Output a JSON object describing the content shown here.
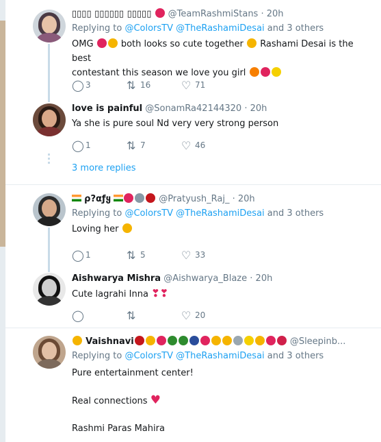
{
  "tweets": [
    {
      "name": "▯▯▯▯ ▯▯▯▯▯▯ ▯▯▯▯▯",
      "handle": "@TeamRashmiStans",
      "time": "· 20h",
      "replying_prefix": "Replying to",
      "mention1": "@ColorsTV",
      "mention2": "@TheRashamiDesai",
      "replying_suffix": "and 3 others",
      "text1": "OMG",
      "text2": "both looks so cute together",
      "text3": "Rashami Desai is the best",
      "text4": "contestant this season we love you girl",
      "replies": "3",
      "retweets": "16",
      "likes": "71"
    },
    {
      "name": "love is painful",
      "handle": "@SonamRa42144320",
      "time": "· 20h",
      "text1": "Ya she is pure soul Nd very very strong person",
      "replies": "1",
      "retweets": "7",
      "likes": "46"
    },
    {
      "more_replies": "3 more replies"
    },
    {
      "name": "ρ?αƒყ",
      "handle": "@Pratyush_Raj_",
      "time": "· 20h",
      "replying_prefix": "Replying to",
      "mention1": "@ColorsTV",
      "mention2": "@TheRashamiDesai",
      "replying_suffix": "and 3 others",
      "text1": "Loving her",
      "replies": "1",
      "retweets": "5",
      "likes": "33"
    },
    {
      "name": "Aishwarya Mishra",
      "handle": "@Aishwarya_Blaze",
      "time": "· 20h",
      "text1": "Cute lagrahi Inna",
      "likes": "20"
    },
    {
      "name": "Vaishnavi",
      "handle": "@Sleepinb...",
      "replying_prefix": "Replying to",
      "mention1": "@ColorsTV",
      "mention2": "@TheRashamiDesai",
      "replying_suffix": "and 3 others",
      "text1": "Pure entertainment center!",
      "text2": "Real connections",
      "text3": "Rashmi Paras Mahira"
    }
  ],
  "colors": {
    "link": "#1da1f2",
    "muted": "#657786",
    "heart": "#e0245e",
    "thread": "#c8dbe8"
  },
  "icons": [
    "reply-icon",
    "retweet-icon",
    "like-icon"
  ]
}
